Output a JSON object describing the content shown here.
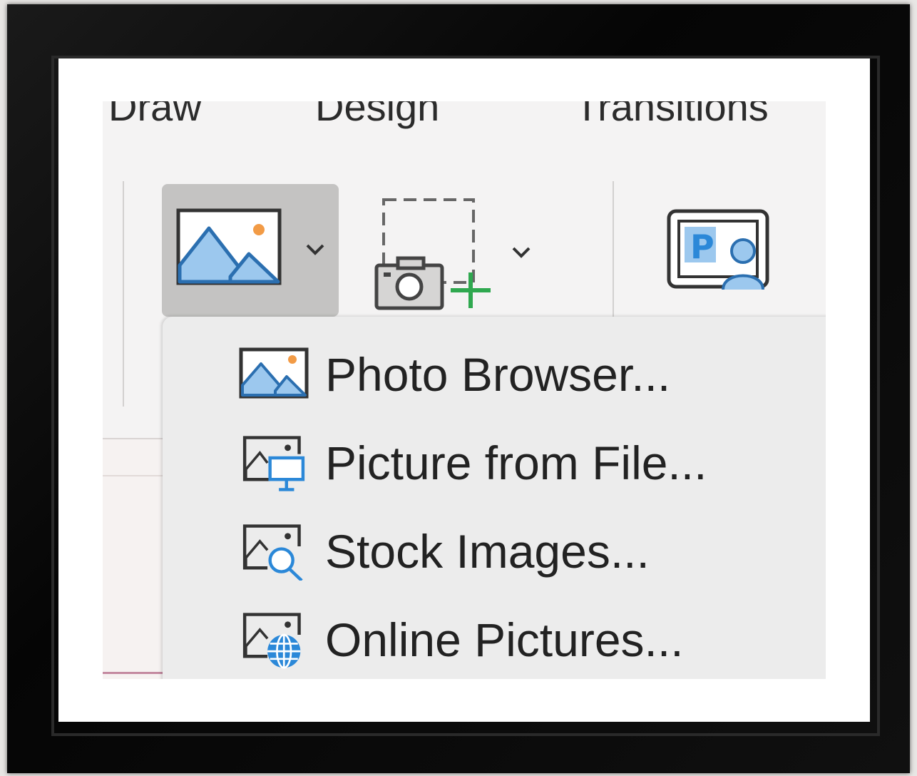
{
  "tabs": [
    {
      "label": "Draw"
    },
    {
      "label": "Design"
    },
    {
      "label": "Transitions"
    }
  ],
  "ribbon": {
    "pictures_button_icon": "picture-mountains-icon",
    "screenshot_button_icon": "screenshot-camera-add-icon",
    "photo_album_button_icon": "photo-album-presentation-icon"
  },
  "menu": {
    "items": [
      {
        "label": "Photo Browser...",
        "icon": "photo-browser-icon"
      },
      {
        "label": "Picture from File...",
        "icon": "picture-from-file-icon"
      },
      {
        "label": "Stock Images...",
        "icon": "stock-images-icon"
      },
      {
        "label": "Online Pictures...",
        "icon": "online-pictures-icon"
      }
    ]
  },
  "colors": {
    "icon_blue": "#2b88d8",
    "icon_light_blue": "#9cc8ee",
    "icon_orange": "#f29b46",
    "plus_green": "#2fa84f",
    "selected_button": "#c4c3c2",
    "menu_background": "#ececec"
  }
}
